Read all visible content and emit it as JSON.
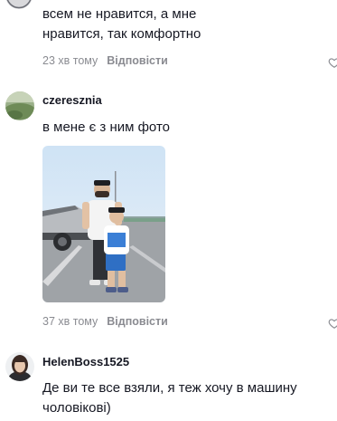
{
  "comments": [
    {
      "text": "всем не нравится, а мне нравится, так комфортно",
      "time": "23 хв тому",
      "reply_label": "Відповісти"
    },
    {
      "username": "czeresznia",
      "text": "в мене є з ним фото",
      "time": "37 хв тому",
      "reply_label": "Відповісти"
    },
    {
      "username": "HelenBoss1525",
      "text": "Де ви те все взяли, я теж хочу в машину чоловікові)"
    }
  ],
  "icons": {
    "like": "heart-outline-icon"
  },
  "colors": {
    "text": "#161823",
    "muted": "#8a8b91"
  }
}
